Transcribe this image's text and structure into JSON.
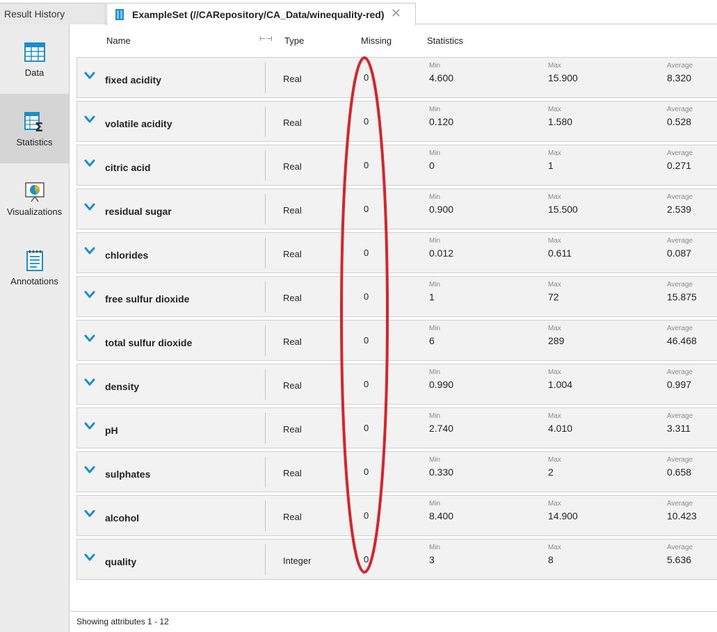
{
  "tabs": [
    {
      "label": "Result History",
      "active": false
    },
    {
      "label": "ExampleSet (//CARepository/CA_Data/winequality-red)",
      "active": true,
      "close_icon": "close-icon"
    }
  ],
  "sidebar": {
    "items": [
      {
        "label": "Data",
        "icon": "table-icon",
        "active": false
      },
      {
        "label": "Statistics",
        "icon": "statistics-icon",
        "active": true
      },
      {
        "label": "Visualizations",
        "icon": "visualizations-icon",
        "active": false
      },
      {
        "label": "Annotations",
        "icon": "annotations-icon",
        "active": false
      }
    ]
  },
  "header": {
    "name": "Name",
    "type": "Type",
    "missing": "Missing",
    "statistics": "Statistics"
  },
  "stat_labels": {
    "min": "Min",
    "max": "Max",
    "average": "Average"
  },
  "attributes": [
    {
      "name": "fixed acidity",
      "type": "Real",
      "missing": "0",
      "min": "4.600",
      "max": "15.900",
      "average": "8.320"
    },
    {
      "name": "volatile acidity",
      "type": "Real",
      "missing": "0",
      "min": "0.120",
      "max": "1.580",
      "average": "0.528"
    },
    {
      "name": "citric acid",
      "type": "Real",
      "missing": "0",
      "min": "0",
      "max": "1",
      "average": "0.271"
    },
    {
      "name": "residual sugar",
      "type": "Real",
      "missing": "0",
      "min": "0.900",
      "max": "15.500",
      "average": "2.539"
    },
    {
      "name": "chlorides",
      "type": "Real",
      "missing": "0",
      "min": "0.012",
      "max": "0.611",
      "average": "0.087"
    },
    {
      "name": "free sulfur dioxide",
      "type": "Real",
      "missing": "0",
      "min": "1",
      "max": "72",
      "average": "15.875"
    },
    {
      "name": "total sulfur dioxide",
      "type": "Real",
      "missing": "0",
      "min": "6",
      "max": "289",
      "average": "46.468"
    },
    {
      "name": "density",
      "type": "Real",
      "missing": "0",
      "min": "0.990",
      "max": "1.004",
      "average": "0.997"
    },
    {
      "name": "pH",
      "type": "Real",
      "missing": "0",
      "min": "2.740",
      "max": "4.010",
      "average": "3.311"
    },
    {
      "name": "sulphates",
      "type": "Real",
      "missing": "0",
      "min": "0.330",
      "max": "2",
      "average": "0.658"
    },
    {
      "name": "alcohol",
      "type": "Real",
      "missing": "0",
      "min": "8.400",
      "max": "14.900",
      "average": "10.423"
    },
    {
      "name": "quality",
      "type": "Integer",
      "missing": "0",
      "min": "3",
      "max": "8",
      "average": "5.636"
    }
  ],
  "footer": {
    "text": "Showing attributes 1 - 12"
  },
  "colors": {
    "accent": "#1a8fd0",
    "annotation": "#d9222a",
    "active_sidebar": "#d5d5d5"
  }
}
